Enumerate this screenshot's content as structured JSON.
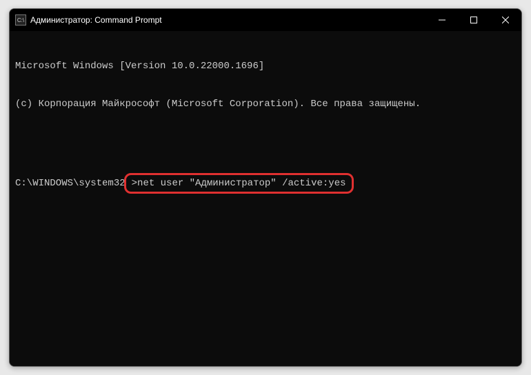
{
  "titlebar": {
    "icon_label": "cmd-icon",
    "title": "Администратор: Command Prompt",
    "minimize": "—",
    "maximize": "▢",
    "close": "✕"
  },
  "terminal": {
    "line1": "Microsoft Windows [Version 10.0.22000.1696]",
    "line2": "(c) Корпорация Майкрософт (Microsoft Corporation). Все права защищены.",
    "prompt_prefix": "C:\\WINDOWS\\system32",
    "prompt_char": ">",
    "command": "net user \"Администратор\" /active:yes"
  }
}
